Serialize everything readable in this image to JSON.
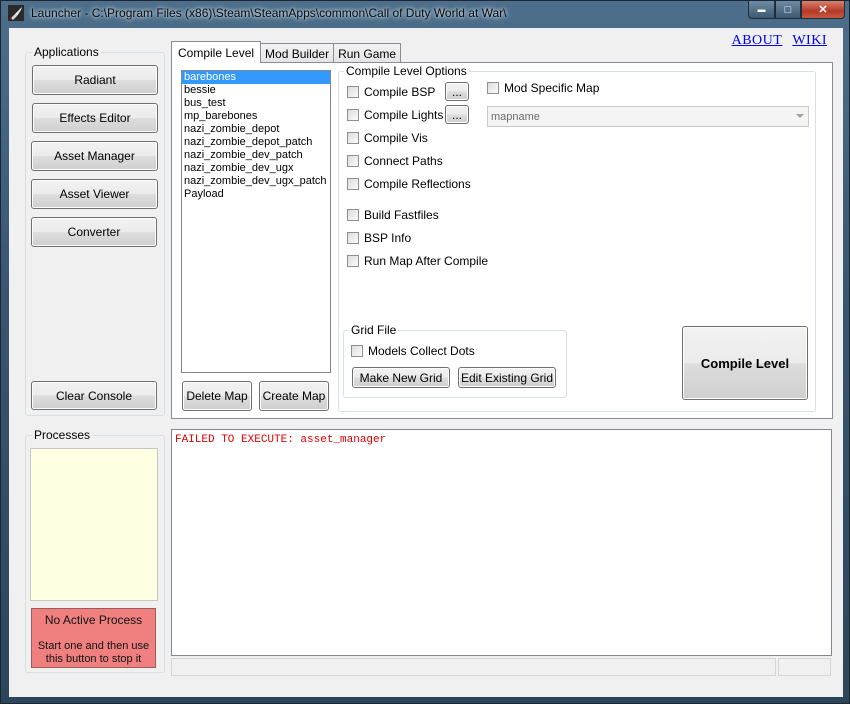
{
  "window": {
    "title": "Launcher - C:\\Program Files (x86)\\Steam\\SteamApps\\common\\Call of Duty World at War\\",
    "controls": {
      "minimize": "▬",
      "maximize": "□",
      "close": "✕"
    }
  },
  "links": {
    "about": "ABOUT",
    "wiki": "WIKI"
  },
  "applications": {
    "label": "Applications",
    "buttons": [
      "Radiant",
      "Effects Editor",
      "Asset Manager",
      "Asset Viewer",
      "Converter"
    ],
    "clear_console": "Clear Console"
  },
  "processes": {
    "label": "Processes",
    "status_title": "No Active Process",
    "status_hint": "Start one and then use this button to stop it"
  },
  "tabs": [
    "Compile Level",
    "Mod Builder",
    "Run Game"
  ],
  "maps": {
    "items": [
      "barebones",
      "bessie",
      "bus_test",
      "mp_barebones",
      "nazi_zombie_depot",
      "nazi_zombie_depot_patch",
      "nazi_zombie_dev_patch",
      "nazi_zombie_dev_ugx",
      "nazi_zombie_dev_ugx_patch",
      "Payload"
    ],
    "selected": "barebones",
    "delete_label": "Delete Map",
    "create_label": "Create Map"
  },
  "compile_options": {
    "label": "Compile Level Options",
    "compile_bsp": "Compile BSP",
    "compile_lights": "Compile Lights",
    "compile_vis": "Compile Vis",
    "connect_paths": "Connect Paths",
    "compile_reflections": "Compile Reflections",
    "build_fastfiles": "Build Fastfiles",
    "bsp_info": "BSP Info",
    "run_map": "Run Map After Compile",
    "mod_specific_map": "Mod Specific Map",
    "mapname_value": "mapname",
    "ellipsis": "..."
  },
  "grid_file": {
    "label": "Grid File",
    "models_collect_dots": "Models Collect Dots",
    "make_new": "Make New Grid",
    "edit_existing": "Edit Existing Grid"
  },
  "compile_button": "Compile Level",
  "console": {
    "line": "FAILED TO EXECUTE: asset_manager",
    "color": "#e00000"
  },
  "colors": {
    "process_bg": "#ffffe1",
    "kill_button": "#f08080",
    "selection": "#3399ff"
  }
}
